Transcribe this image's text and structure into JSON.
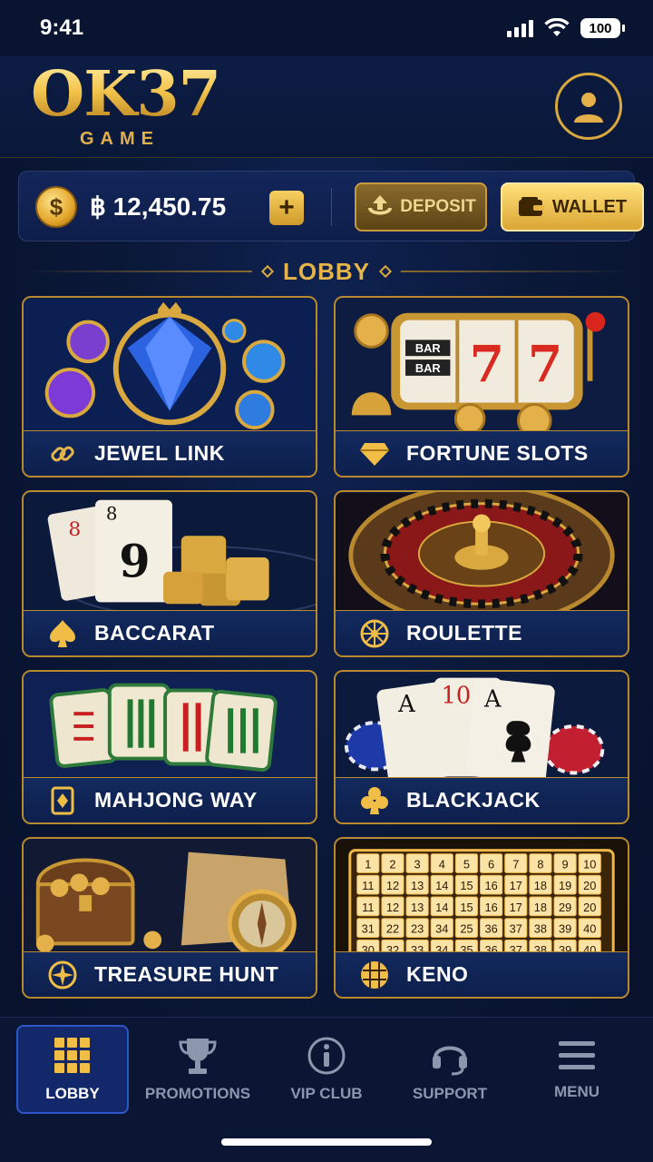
{
  "status_bar": {
    "time": "9:41",
    "battery": "100"
  },
  "header": {
    "logo_main": "OK37",
    "logo_sub": "GAME"
  },
  "balance": {
    "currency_symbol": "$",
    "amount": "฿ 12,450.75",
    "add_label": "+",
    "deposit_label": "DEPOSIT",
    "wallet_label": "WALLET"
  },
  "lobby": {
    "title": "LOBBY",
    "games": [
      {
        "name": "JEWEL LINK",
        "icon": "link-icon"
      },
      {
        "name": "FORTUNE SLOTS",
        "icon": "diamond-icon"
      },
      {
        "name": "BACCARAT",
        "icon": "spade-icon"
      },
      {
        "name": "ROULETTE",
        "icon": "roulette-wheel-icon"
      },
      {
        "name": "MAHJONG WAY",
        "icon": "mahjong-tile-icon"
      },
      {
        "name": "BLACKJACK",
        "icon": "club-icon"
      },
      {
        "name": "TREASURE HUNT",
        "icon": "compass-icon"
      },
      {
        "name": "KENO",
        "icon": "grid-ball-icon"
      }
    ]
  },
  "art_text": {
    "slot_bar_1": "BAR",
    "slot_bar_2": "BAR",
    "slot_seven": "7",
    "baccarat_card_1": "8",
    "baccarat_card_2": "8",
    "baccarat_card_2_big": "9",
    "blackjack_card_1": "A",
    "blackjack_card_2": "10",
    "blackjack_card_3": "A",
    "keno_numbers": [
      "1",
      "2",
      "3",
      "4",
      "5",
      "6",
      "7",
      "8",
      "9",
      "10",
      "11",
      "12",
      "13",
      "14",
      "15",
      "16",
      "17",
      "18",
      "19",
      "20",
      "11",
      "12",
      "13",
      "14",
      "15",
      "16",
      "17",
      "18",
      "29",
      "20",
      "31",
      "22",
      "23",
      "34",
      "25",
      "36",
      "37",
      "38",
      "39",
      "40",
      "30",
      "32",
      "33",
      "34",
      "35",
      "36",
      "37",
      "38",
      "39",
      "40"
    ]
  },
  "nav": {
    "items": [
      {
        "label": "LOBBY",
        "icon": "grid-icon",
        "active": true
      },
      {
        "label": "PROMOTIONS",
        "icon": "trophy-icon",
        "active": false
      },
      {
        "label": "VIP CLUB",
        "icon": "info-icon",
        "active": false
      },
      {
        "label": "SUPPORT",
        "icon": "headset-icon",
        "active": false
      },
      {
        "label": "MENU",
        "icon": "hamburger-icon",
        "active": false
      }
    ]
  },
  "colors": {
    "gold": "#d9a83e",
    "navy": "#0a1838",
    "accent_blue": "#2f56c8"
  }
}
